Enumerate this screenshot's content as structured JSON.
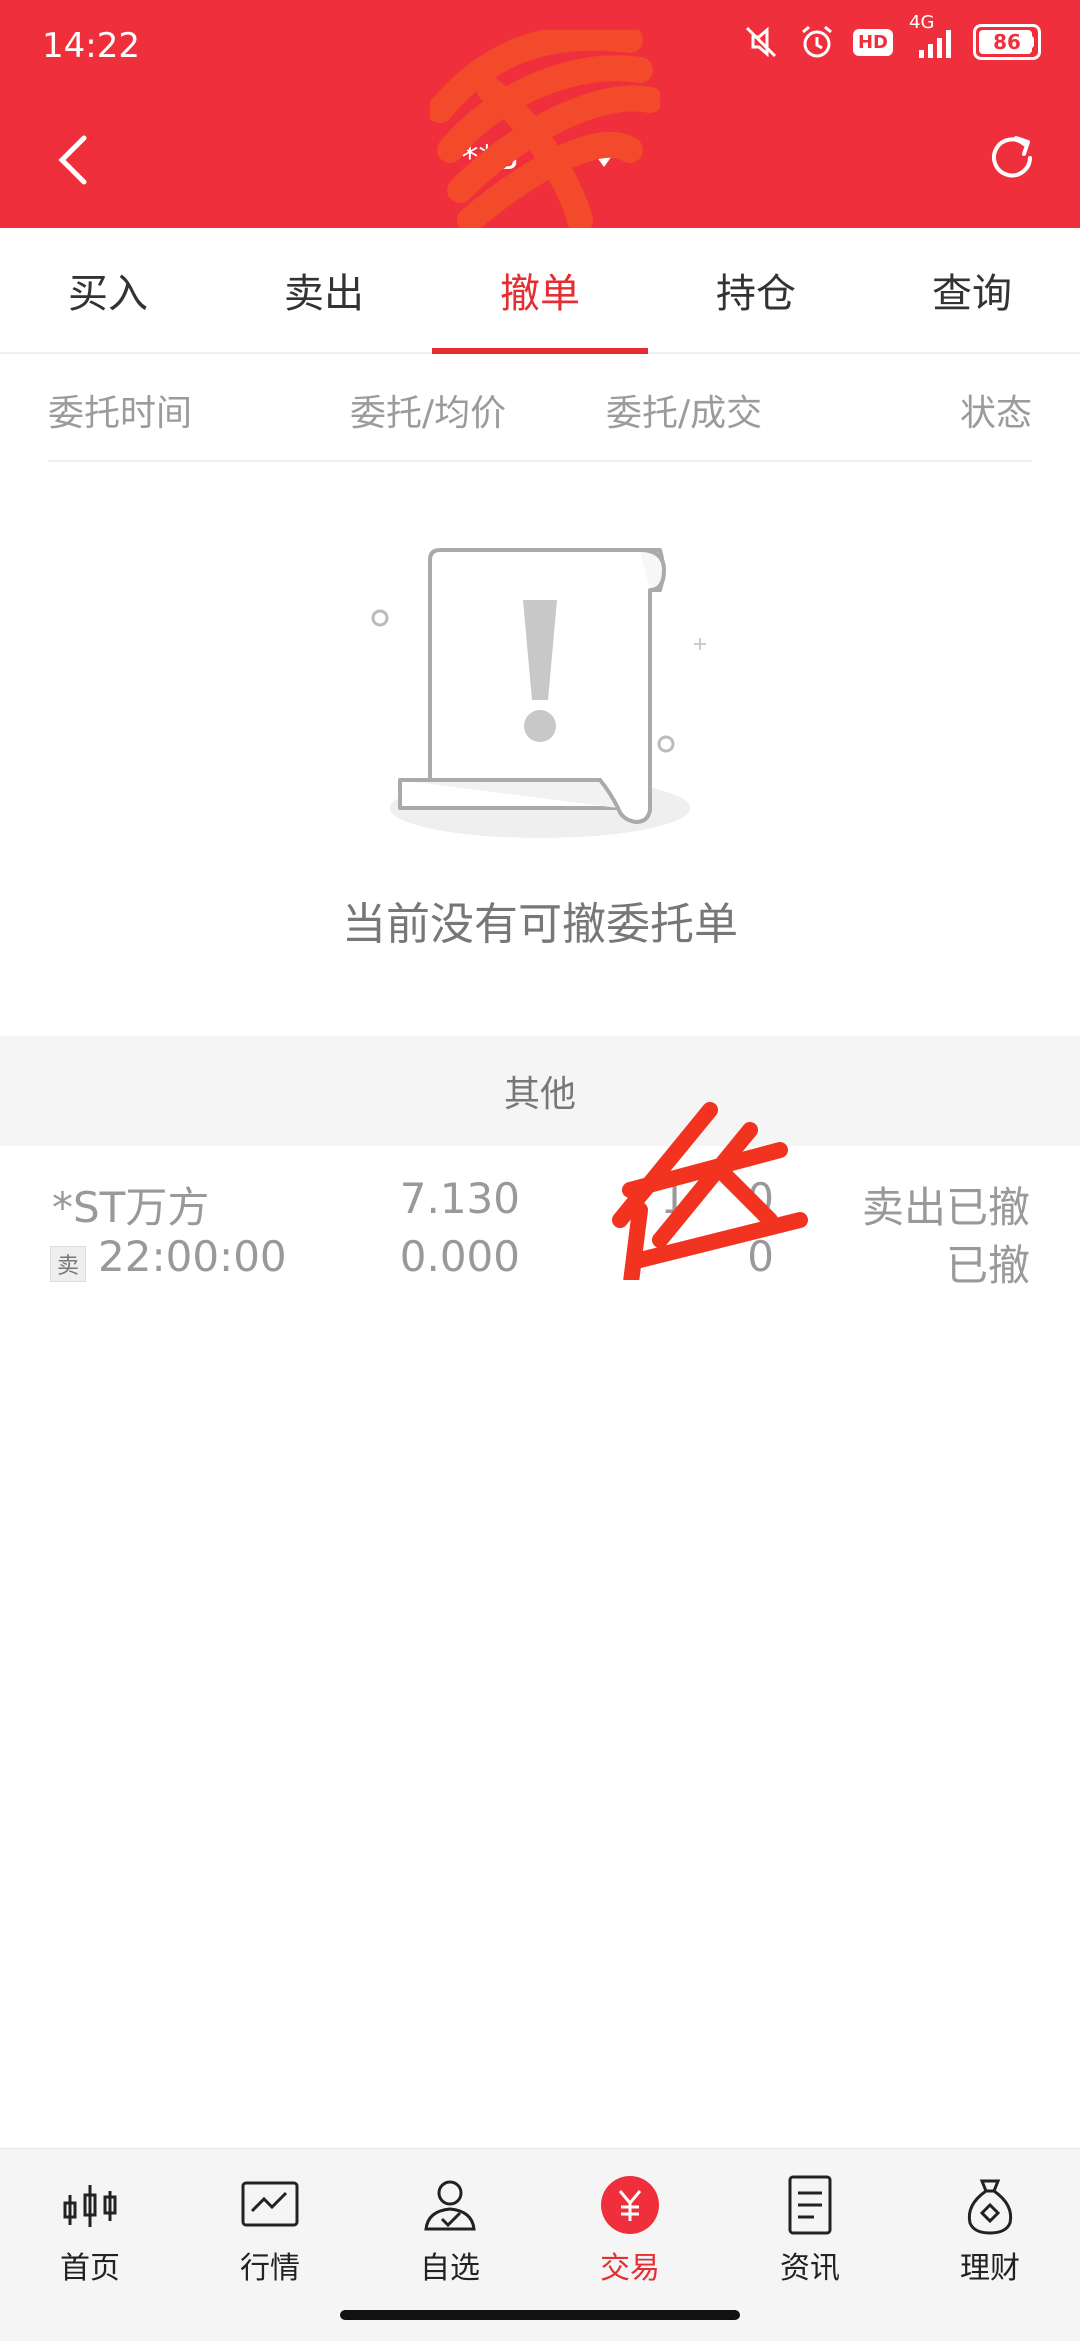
{
  "status_bar": {
    "time": "14:22",
    "network": "4G",
    "hd_label": "HD",
    "battery": "86"
  },
  "header": {
    "title_visible": "**B",
    "title_masked_char": "乎",
    "background_color": "#ef2f3c"
  },
  "tabs": [
    {
      "label": "买入",
      "active": false
    },
    {
      "label": "卖出",
      "active": false
    },
    {
      "label": "撤单",
      "active": true
    },
    {
      "label": "持仓",
      "active": false
    },
    {
      "label": "查询",
      "active": false
    }
  ],
  "columns": {
    "time": "委托时间",
    "price": "委托/均价",
    "volume": "委托/成交",
    "status": "状态"
  },
  "empty_state": {
    "message": "当前没有可撤委托单"
  },
  "other_section": {
    "title": "其他",
    "orders": [
      {
        "name": "*ST万方",
        "side": "卖",
        "time": "22:00:00",
        "order_price": "7.130",
        "avg_price": "0.000",
        "order_qty": "1",
        "order_qty_tail": "0",
        "filled_qty": "0",
        "status_main": "卖出已撤",
        "status_sub": "已撤"
      }
    ]
  },
  "bottom_nav": [
    {
      "label": "首页",
      "icon": "candlestick-icon",
      "active": false
    },
    {
      "label": "行情",
      "icon": "chart-line-icon",
      "active": false
    },
    {
      "label": "自选",
      "icon": "user-check-icon",
      "active": false
    },
    {
      "label": "交易",
      "icon": "yen-circle-icon",
      "active": true
    },
    {
      "label": "资讯",
      "icon": "document-icon",
      "active": false
    },
    {
      "label": "理财",
      "icon": "money-bag-icon",
      "active": false
    }
  ],
  "colors": {
    "accent": "#e42e33",
    "muted_text": "#999999"
  }
}
